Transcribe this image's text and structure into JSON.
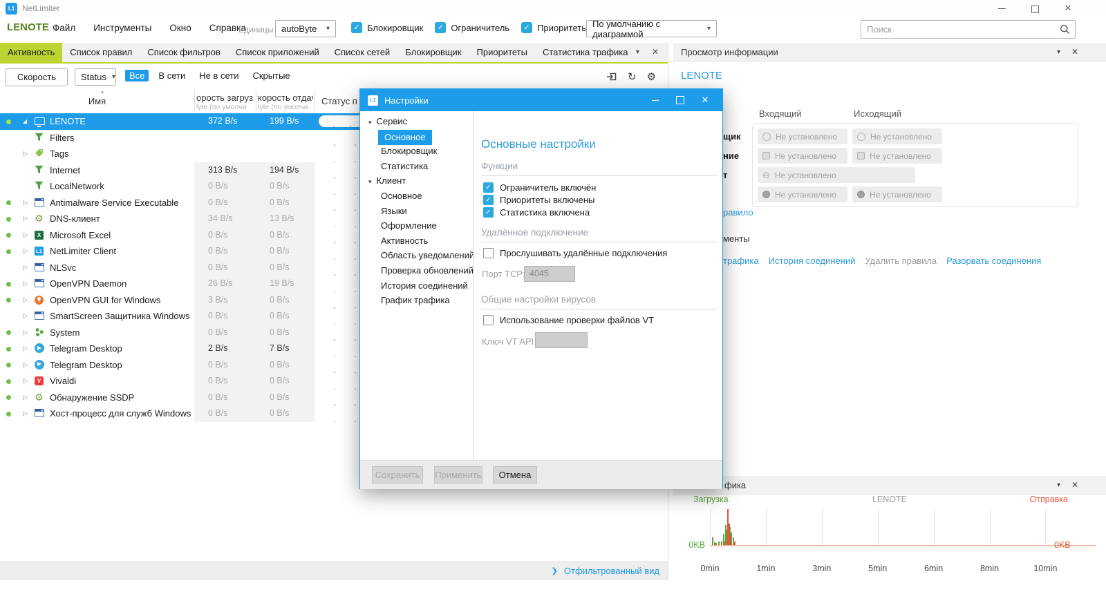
{
  "glyphs": {
    "check": "✓",
    "caret_down": "▾",
    "sort_asc": "▴",
    "expander_open": "◢",
    "expander_closed": "▷",
    "close": "✕",
    "chevron_right": "❯",
    "refresh": "↻",
    "gear": "⚙",
    "circle_minus": "⊖"
  },
  "titlebar": {
    "app_title": "NetLimiter",
    "logo_text": "L1"
  },
  "menubar": {
    "brand": "LENOTE",
    "items": [
      "Файл",
      "Инструменты",
      "Окно",
      "Справка"
    ],
    "units_label": "Единицы",
    "units_value": "autoByte",
    "toggles": [
      {
        "label": "Блокировщик",
        "checked": true
      },
      {
        "label": "Ограничитель",
        "checked": true
      },
      {
        "label": "Приоритеты",
        "checked": true
      }
    ],
    "layout_select_value": "По умолчанию с диаграммой",
    "search_placeholder": "Поиск"
  },
  "tabs": {
    "active": "Активность",
    "items": [
      "Активность",
      "Список правил",
      "Список фильтров",
      "Список приложений",
      "Список сетей",
      "Блокировщик",
      "Приоритеты",
      "Статистика трафика"
    ]
  },
  "activity_toolbar": {
    "speed_button": "Скорость",
    "status_dropdown": "Status",
    "filters": [
      {
        "label": "Все",
        "active": true
      },
      {
        "label": "В сети",
        "active": false
      },
      {
        "label": "Не в сети",
        "active": false
      },
      {
        "label": "Скрытые",
        "active": false
      }
    ]
  },
  "table": {
    "header": {
      "name": "Имя",
      "down_line1": "орость загруз",
      "down_line2": "lyte (по умолча",
      "up_line1": "корость отдач",
      "up_line2": "lyte (по умолча",
      "status": "Статус п"
    },
    "rows": [
      {
        "name": "LENOTE",
        "icon": "monitor",
        "down": "372 B/s",
        "up": "199 B/s",
        "dot": true,
        "expander": "open",
        "selected": true
      },
      {
        "name": "Filters",
        "icon": "funnel",
        "down": "",
        "up": ""
      },
      {
        "name": "Tags",
        "icon": "tag",
        "down": "",
        "up": "",
        "expander": "closed"
      },
      {
        "name": "Internet",
        "icon": "funnel",
        "down": "313 B/s",
        "up": "194 B/s",
        "strong": true
      },
      {
        "name": "LocalNetwork",
        "icon": "funnel",
        "down": "0 B/s",
        "up": "0 B/s"
      },
      {
        "name": "Antimalware Service Executable",
        "icon": "app",
        "down": "0 B/s",
        "up": "0 B/s",
        "dot": true,
        "expander": "closed"
      },
      {
        "name": "DNS-клиент",
        "icon": "gear",
        "down": "34 B/s",
        "up": "13 B/s",
        "dot": true,
        "expander": "closed"
      },
      {
        "name": "Microsoft Excel",
        "icon": "excel",
        "down": "0 B/s",
        "up": "0 B/s",
        "dot": true,
        "expander": "closed"
      },
      {
        "name": "NetLimiter Client",
        "icon": "netlimiter",
        "down": "0 B/s",
        "up": "0 B/s",
        "dot": true,
        "expander": "closed"
      },
      {
        "name": "NLSvc",
        "icon": "app",
        "down": "0 B/s",
        "up": "0 B/s",
        "expander": "closed"
      },
      {
        "name": "OpenVPN Daemon",
        "icon": "app",
        "down": "26 B/s",
        "up": "19 B/s",
        "dot": true,
        "expander": "closed"
      },
      {
        "name": "OpenVPN GUI for Windows",
        "icon": "openvpn",
        "down": "3 B/s",
        "up": "0 B/s",
        "dot": true,
        "expander": "closed"
      },
      {
        "name": "SmartScreen Защитника Windows",
        "icon": "app",
        "down": "0 B/s",
        "up": "0 B/s",
        "expander": "closed"
      },
      {
        "name": "System",
        "icon": "system",
        "down": "0 B/s",
        "up": "0 B/s",
        "dot": true,
        "expander": "closed"
      },
      {
        "name": "Telegram Desktop",
        "icon": "telegram",
        "down": "2 B/s",
        "up": "7 B/s",
        "dot": true,
        "expander": "closed",
        "strong": true
      },
      {
        "name": "Telegram Desktop",
        "icon": "telegram",
        "down": "0 B/s",
        "up": "0 B/s",
        "dot": true,
        "expander": "closed"
      },
      {
        "name": "Vivaldi",
        "icon": "vivaldi",
        "down": "0 B/s",
        "up": "0 B/s",
        "dot": true,
        "expander": "closed"
      },
      {
        "name": "Обнаружение SSDP",
        "icon": "gear",
        "down": "0 B/s",
        "up": "0 B/s",
        "dot": true,
        "expander": "closed"
      },
      {
        "name": "Хост-процесс для служб Windows",
        "icon": "app",
        "down": "0 B/s",
        "up": "0 B/s",
        "dot": true,
        "expander": "closed"
      }
    ]
  },
  "statusbar": {
    "filtered_view": "Отфильтрованный вид"
  },
  "info_panel": {
    "title": "Просмотр информации",
    "heading": "LENOTE",
    "col_in": "Входящий",
    "col_out": "Исходящий",
    "rows": [
      {
        "label_fragment": "щик",
        "icon": "circle",
        "cells": [
          "Не установлено",
          "Не установлено"
        ],
        "wide": false
      },
      {
        "label_fragment": "ние",
        "icon": "square",
        "cells": [
          "Не установлено",
          "Не установлено"
        ],
        "wide": false
      },
      {
        "label_fragment": "т",
        "icon": "circle-minus",
        "cells": [
          "Не установлено"
        ],
        "wide": true
      },
      {
        "label_fragment": "",
        "icon": "dark",
        "cells": [
          "Не установлено",
          "Не установлено"
        ],
        "wide": false
      }
    ],
    "rule_link_fragment": "равило",
    "tools_fragment": "менты",
    "links": [
      {
        "label": "трафика",
        "disabled": false
      },
      {
        "label": "История соединений",
        "disabled": false
      },
      {
        "label": "Удалить правила",
        "disabled": true
      },
      {
        "label": "Разорвать соединения",
        "disabled": false
      }
    ]
  },
  "dialog": {
    "title": "Настройки",
    "logo_text": "L1",
    "tree": [
      {
        "label": "Сервис",
        "type": "group"
      },
      {
        "label": "Основное",
        "type": "child",
        "selected": true
      },
      {
        "label": "Блокировщик",
        "type": "child"
      },
      {
        "label": "Статистика",
        "type": "child"
      },
      {
        "label": "Клиент",
        "type": "group"
      },
      {
        "label": "Основное",
        "type": "child"
      },
      {
        "label": "Языки",
        "type": "child"
      },
      {
        "label": "Оформление",
        "type": "child"
      },
      {
        "label": "Активность",
        "type": "child"
      },
      {
        "label": "Область уведомлений",
        "type": "child"
      },
      {
        "label": "Проверка обновлений",
        "type": "child"
      },
      {
        "label": "История соединений",
        "type": "child"
      },
      {
        "label": "График трафика",
        "type": "child"
      }
    ],
    "heading": "Основные настройки",
    "sections": {
      "functions": {
        "title": "Функции",
        "checkboxes": [
          "Ограничитель включён",
          "Приоритеты включены",
          "Статистика включена"
        ]
      },
      "remote": {
        "title": "Удалённое подключение",
        "checkbox": "Прослушивать удалённые подключения",
        "port_label": "Порт TCP:",
        "port_value": "4045"
      },
      "virus": {
        "title": "Общие настройки вирусов",
        "checkbox": "Использование проверки файлов VT",
        "key_label": "Ключ VT API:",
        "key_value": ""
      }
    },
    "buttons": [
      {
        "label": "Сохранить",
        "enabled": false
      },
      {
        "label": "Применить",
        "enabled": false
      },
      {
        "label": "Отмена",
        "enabled": true
      }
    ]
  },
  "chart_panel": {
    "title_fragment": "фика",
    "legend_download": "Загрузка",
    "center_label": "LENOTE",
    "legend_upload": "Отправка",
    "y_left": "0KB",
    "y_right": "0KB"
  },
  "chart_data": {
    "type": "bar",
    "title": "LENOTE",
    "legend": [
      {
        "name": "Загрузка",
        "color": "#58a83c",
        "position": "left"
      },
      {
        "name": "Отправка",
        "color": "#e2553a",
        "position": "right"
      }
    ],
    "x_tick_labels": [
      "0min",
      "1min",
      "3min",
      "5min",
      "6min",
      "8min",
      "10min"
    ],
    "y_axis": {
      "left_label": "0KB",
      "right_label": "0KB"
    },
    "grid": "vertical",
    "series": [
      {
        "name": "Загрузка",
        "points_frac": [
          [
            0.006,
            0.22
          ],
          [
            0.012,
            0.08
          ],
          [
            0.025,
            0.1
          ],
          [
            0.033,
            0.12
          ],
          [
            0.04,
            0.3
          ],
          [
            0.046,
            0.55
          ],
          [
            0.05,
            0.42
          ],
          [
            0.058,
            0.5
          ],
          [
            0.062,
            0.35
          ],
          [
            0.068,
            0.22
          ]
        ]
      },
      {
        "name": "Отправка",
        "points_frac": [
          [
            0.016,
            0.06
          ],
          [
            0.043,
            0.1
          ],
          [
            0.052,
            1.0
          ],
          [
            0.056,
            0.6
          ],
          [
            0.06,
            0.25
          ],
          [
            0.072,
            0.1
          ]
        ]
      }
    ]
  }
}
